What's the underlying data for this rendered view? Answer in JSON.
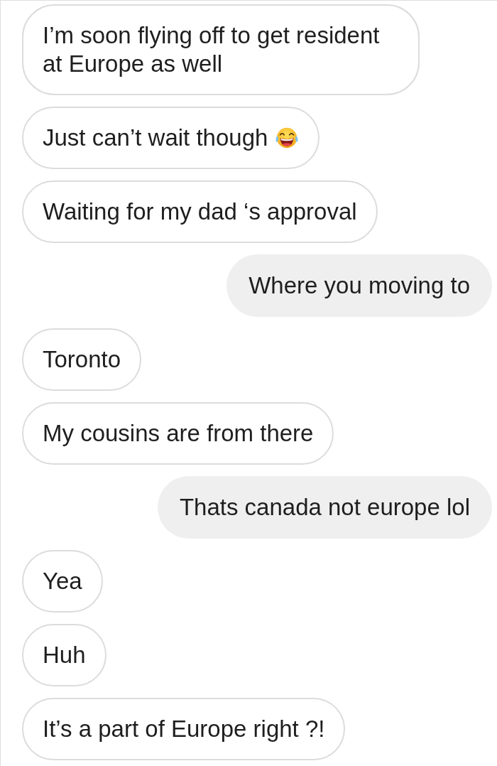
{
  "messages": [
    {
      "kind": "received",
      "text": "I’m soon flying off to get resident at Europe as well"
    },
    {
      "kind": "received",
      "text": "Just can’t wait though",
      "emoji": true
    },
    {
      "kind": "received",
      "text": "Waiting for my dad ‘s approval"
    },
    {
      "kind": "sent",
      "text": "Where you moving to"
    },
    {
      "kind": "received",
      "text": "Toronto"
    },
    {
      "kind": "received",
      "text": "My cousins are from there"
    },
    {
      "kind": "sent",
      "text": "Thats canada not europe lol"
    },
    {
      "kind": "received",
      "text": "Yea"
    },
    {
      "kind": "received",
      "text": "Huh"
    },
    {
      "kind": "received",
      "text": "It’s a part of Europe right ?!"
    }
  ]
}
